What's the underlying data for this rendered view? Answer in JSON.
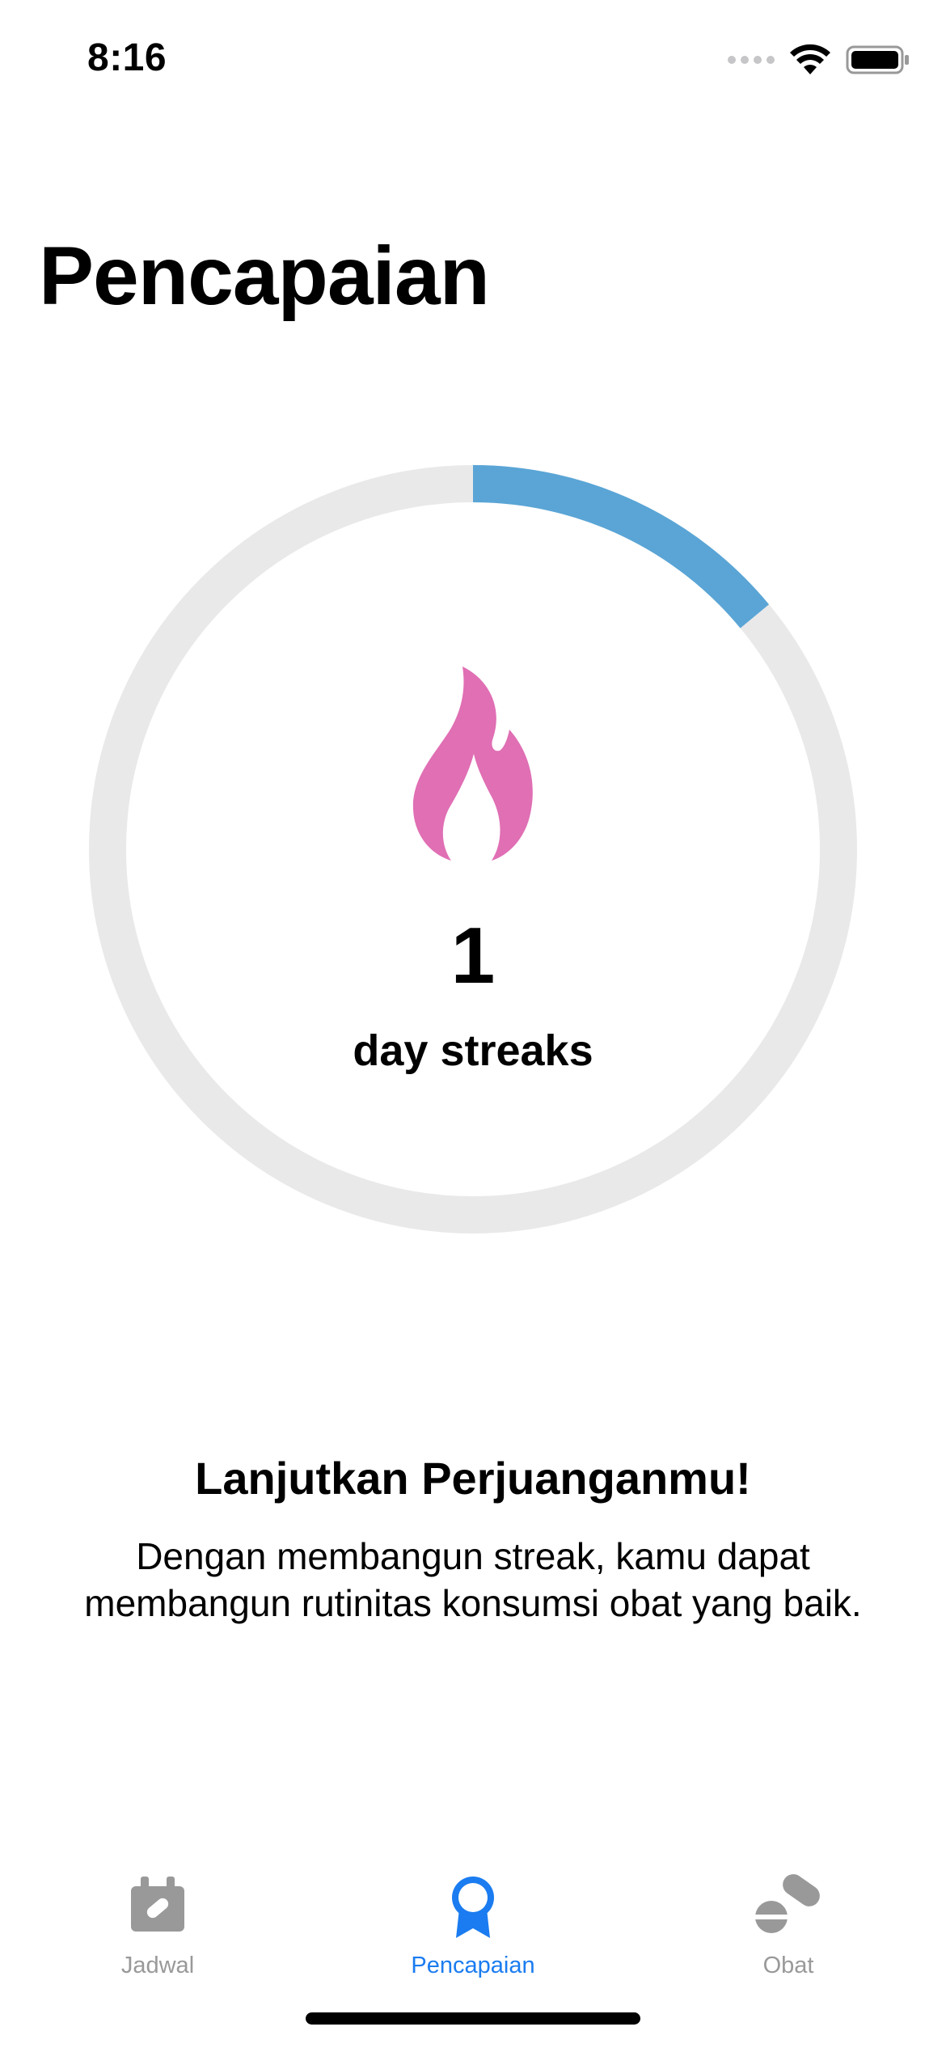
{
  "status_bar": {
    "time": "8:16"
  },
  "page": {
    "title": "Pencapaian"
  },
  "streak": {
    "count": "1",
    "unit_label": "day streaks",
    "progress_fraction": 0.14,
    "progress_color": "#5aa5d6",
    "track_color": "#e9e9e9",
    "icon": "flame-icon",
    "icon_color": "#e06fb4"
  },
  "motivation": {
    "title": "Lanjutkan Perjuanganmu!",
    "body": "Dengan membangun streak, kamu dapat membangun rutinitas konsumsi obat yang baik."
  },
  "tab_bar": {
    "active_color": "#1a7cf0",
    "inactive_color": "#999999",
    "tabs": [
      {
        "label": "Jadwal",
        "icon": "calendar-pill-icon",
        "active": false
      },
      {
        "label": "Pencapaian",
        "icon": "award-ribbon-icon",
        "active": true
      },
      {
        "label": "Obat",
        "icon": "pills-icon",
        "active": false
      }
    ]
  }
}
